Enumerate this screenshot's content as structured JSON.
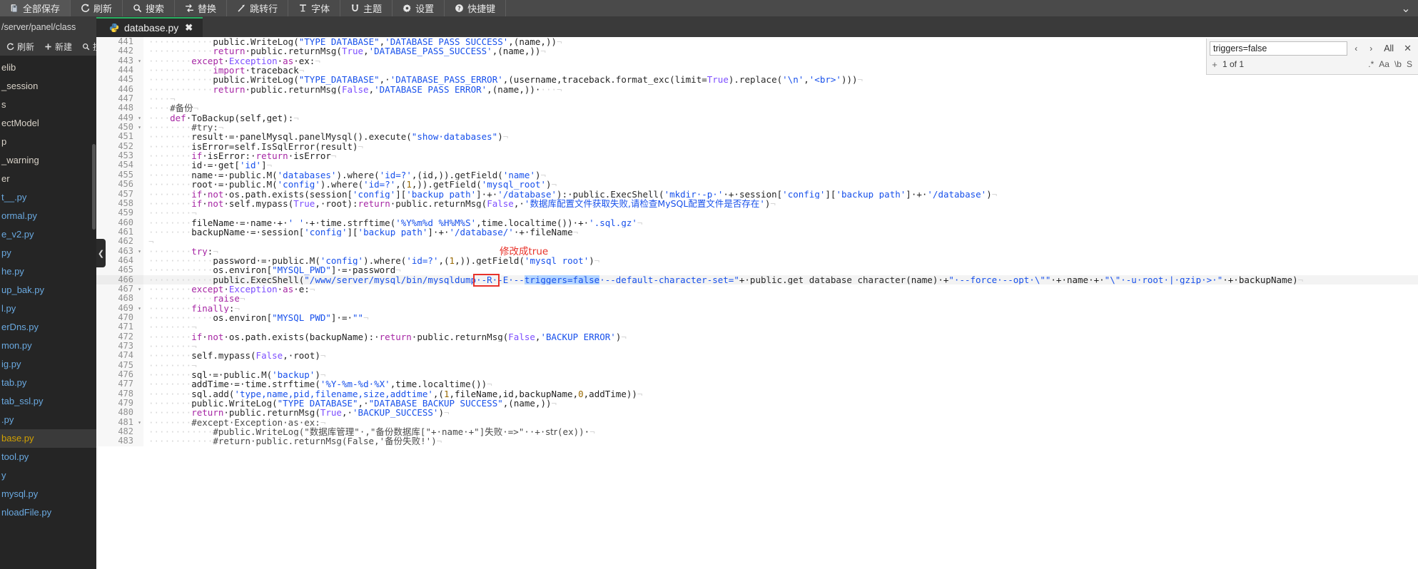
{
  "toolbar": {
    "items": [
      {
        "label": "全部保存",
        "icon": "save-all-icon"
      },
      {
        "label": "刷新",
        "icon": "refresh-icon"
      },
      {
        "label": "搜索",
        "icon": "search-icon"
      },
      {
        "label": "替换",
        "icon": "replace-icon"
      },
      {
        "label": "跳转行",
        "icon": "goto-line-icon"
      },
      {
        "label": "字体",
        "icon": "font-icon"
      },
      {
        "label": "主题",
        "icon": "theme-icon"
      },
      {
        "label": "设置",
        "icon": "gear-icon"
      },
      {
        "label": "快捷键",
        "icon": "help-icon"
      }
    ],
    "collapse_glyph": "⌄"
  },
  "path_bar": {
    "path": "/server/panel/class"
  },
  "tabs": [
    {
      "label": "database.py",
      "icon": "python-file-icon",
      "close_glyph": "✖",
      "active": true
    }
  ],
  "sidebar": {
    "toolbar": [
      {
        "label": "刷新",
        "icon": "refresh-icon"
      },
      {
        "label": "新建",
        "icon": "plus-icon"
      },
      {
        "label": "搜索",
        "icon": "search-icon"
      }
    ],
    "files": [
      {
        "name": "elib",
        "type": "dir"
      },
      {
        "name": "_session",
        "type": "dir"
      },
      {
        "name": "s",
        "type": "dir"
      },
      {
        "name": "ectModel",
        "type": "dir"
      },
      {
        "name": "p",
        "type": "dir"
      },
      {
        "name": "_warning",
        "type": "dir"
      },
      {
        "name": "er",
        "type": "dir"
      },
      {
        "name": "t__.py",
        "type": "file"
      },
      {
        "name": "ormal.py",
        "type": "file"
      },
      {
        "name": "e_v2.py",
        "type": "file"
      },
      {
        "name": "py",
        "type": "file"
      },
      {
        "name": "he.py",
        "type": "file"
      },
      {
        "name": "up_bak.py",
        "type": "file"
      },
      {
        "name": "l.py",
        "type": "file"
      },
      {
        "name": "erDns.py",
        "type": "file"
      },
      {
        "name": "mon.py",
        "type": "file"
      },
      {
        "name": "ig.py",
        "type": "file"
      },
      {
        "name": "tab.py",
        "type": "file"
      },
      {
        "name": "tab_ssl.py",
        "type": "file"
      },
      {
        "name": ".py",
        "type": "file"
      },
      {
        "name": "base.py",
        "type": "file",
        "active": true
      },
      {
        "name": "tool.py",
        "type": "file"
      },
      {
        "name": "y",
        "type": "file"
      },
      {
        "name": "mysql.py",
        "type": "file"
      },
      {
        "name": "nloadFile.py",
        "type": "file"
      }
    ]
  },
  "search_panel": {
    "query": "triggers=false",
    "placeholder": "",
    "prev_glyph": "‹",
    "next_glyph": "›",
    "all_label": "All",
    "close_glyph": "✕",
    "expand_glyph": "+",
    "result_count": "1 of 1",
    "flags": [
      {
        "label": ".*",
        "name": "regex-flag"
      },
      {
        "label": "Aa",
        "name": "match-case-flag"
      },
      {
        "label": "\\b",
        "name": "whole-word-flag"
      },
      {
        "label": "S",
        "name": "search-scope-flag"
      }
    ]
  },
  "annotation": {
    "note": "修改成true",
    "note_color": "#e8322a",
    "box_color": "#e8322a",
    "boxed_token": "false"
  },
  "editor": {
    "first_line": 441,
    "highlighted_line": 466,
    "selection": "triggers=false",
    "lines": [
      {
        "n": 441,
        "fold": "",
        "indent": 12,
        "html": "<span class=\"fn\">public</span>.<span class=\"fn\">WriteLog</span>(<span class=\"str\">\"TYPE_DATABASE\"</span>,<span class=\"str\">'DATABASE_PASS_SUCCESS'</span>,(name,))<span class=\"ws\">¬</span>"
      },
      {
        "n": 442,
        "fold": "",
        "indent": 12,
        "html": "<span class=\"kw\">return</span>·<span class=\"fn\">public</span>.<span class=\"fn\">returnMsg</span>(<span class=\"kw2\">True</span>,<span class=\"str\">'DATABASE_PASS_SUCCESS'</span>,(name,))<span class=\"ws\">¬</span>"
      },
      {
        "n": 443,
        "fold": "▾",
        "indent": 8,
        "html": "<span class=\"kw\">except</span>·<span class=\"kw2\">Exception</span>·<span class=\"kw\">as</span>·ex:<span class=\"ws\">¬</span>"
      },
      {
        "n": 444,
        "fold": "",
        "indent": 12,
        "html": "<span class=\"kw\">import</span>·traceback<span class=\"ws\">¬</span>"
      },
      {
        "n": 445,
        "fold": "",
        "indent": 12,
        "html": "<span class=\"fn\">public</span>.<span class=\"fn\">WriteLog</span>(<span class=\"str\">\"TYPE_DATABASE\"</span>,·<span class=\"str\">'DATABASE_PASS_ERROR'</span>,(username,traceback.<span class=\"fn\">format_exc</span>(limit=<span class=\"kw2\">True</span>).<span class=\"fn\">replace</span>(<span class=\"str\">'\\n'</span>,<span class=\"str\">'&lt;br&gt;'</span>)))<span class=\"ws\">¬</span>"
      },
      {
        "n": 446,
        "fold": "",
        "indent": 12,
        "html": "<span class=\"kw\">return</span>·<span class=\"fn\">public</span>.<span class=\"fn\">returnMsg</span>(<span class=\"kw2\">False</span>,<span class=\"str\">'DATABASE_PASS_ERROR'</span>,(name,))·<span class=\"ws\">···¬</span>"
      },
      {
        "n": 447,
        "fold": "",
        "indent": 4,
        "html": "<span class=\"ws\">¬</span>"
      },
      {
        "n": 448,
        "fold": "",
        "indent": 4,
        "html": "<span class=\"cmt\">#<span class=\"cn\">备份</span></span><span class=\"ws\">¬</span>"
      },
      {
        "n": 449,
        "fold": "▾",
        "indent": 4,
        "html": "<span class=\"kw\">def</span>·<span class=\"fn\">ToBackup</span>(self,get):<span class=\"ws\">¬</span>"
      },
      {
        "n": 450,
        "fold": "▾",
        "indent": 8,
        "html": "<span class=\"cmt\">#try:</span><span class=\"ws\">¬</span>"
      },
      {
        "n": 451,
        "fold": "",
        "indent": 8,
        "html": "result·=·panelMysql.<span class=\"fn\">panelMysql</span>().<span class=\"fn\">execute</span>(<span class=\"str\">\"show·databases\"</span>)<span class=\"ws\">¬</span>"
      },
      {
        "n": 452,
        "fold": "",
        "indent": 8,
        "html": "isError=self.<span class=\"fn\">IsSqlError</span>(result)<span class=\"ws\">¬</span>"
      },
      {
        "n": 453,
        "fold": "",
        "indent": 8,
        "html": "<span class=\"kw\">if</span>·isError:·<span class=\"kw\">return</span>·isError<span class=\"ws\">¬</span>"
      },
      {
        "n": 454,
        "fold": "",
        "indent": 8,
        "html": "id·=·get[<span class=\"str\">'id'</span>]<span class=\"ws\">¬</span>"
      },
      {
        "n": 455,
        "fold": "",
        "indent": 8,
        "html": "name·=·<span class=\"fn\">public</span>.<span class=\"fn\">M</span>(<span class=\"str\">'databases'</span>).<span class=\"fn\">where</span>(<span class=\"str\">'id=?'</span>,(id,)).<span class=\"fn\">getField</span>(<span class=\"str\">'name'</span>)<span class=\"ws\">¬</span>"
      },
      {
        "n": 456,
        "fold": "",
        "indent": 8,
        "html": "root·=·<span class=\"fn\">public</span>.<span class=\"fn\">M</span>(<span class=\"str\">'config'</span>).<span class=\"fn\">where</span>(<span class=\"str\">'id=?'</span>,(<span class=\"num\">1</span>,)).<span class=\"fn\">getField</span>(<span class=\"str\">'mysql_root'</span>)<span class=\"ws\">¬</span>"
      },
      {
        "n": 457,
        "fold": "",
        "indent": 8,
        "html": "<span class=\"kw\">if</span>·<span class=\"kw\">not</span>·os.path.<span class=\"fn\">exists</span>(session[<span class=\"str\">'config'</span>][<span class=\"str\">'backup_path'</span>]·+·<span class=\"str\">'/database'</span>):·<span class=\"fn\">public</span>.<span class=\"fn\">ExecShell</span>(<span class=\"str\">'mkdir·-p·'</span>·+·session[<span class=\"str\">'config'</span>][<span class=\"str\">'backup_path'</span>]·+·<span class=\"str\">'/database'</span>)<span class=\"ws\">¬</span>"
      },
      {
        "n": 458,
        "fold": "",
        "indent": 8,
        "html": "<span class=\"kw\">if</span>·<span class=\"kw\">not</span>·self.<span class=\"fn\">mypass</span>(<span class=\"kw2\">True</span>,·root):<span class=\"kw\">return</span>·<span class=\"fn\">public</span>.<span class=\"fn\">returnMsg</span>(<span class=\"kw2\">False</span>,·<span class=\"str\">'<span class=\"cn\">数据库配置文件获取失败,请检查MySQL配置文件是否存在</span>'</span>)<span class=\"ws\">¬</span>"
      },
      {
        "n": 459,
        "fold": "",
        "indent": 8,
        "html": "<span class=\"ws\">¬</span>"
      },
      {
        "n": 460,
        "fold": "",
        "indent": 8,
        "html": "fileName·=·name·+·<span class=\"str\">'_'</span>·+·time.<span class=\"fn\">strftime</span>(<span class=\"str\">'%Y%m%d_%H%M%S'</span>,time.<span class=\"fn\">localtime</span>())·+·<span class=\"str\">'.sql.gz'</span><span class=\"ws\">¬</span>"
      },
      {
        "n": 461,
        "fold": "",
        "indent": 8,
        "html": "backupName·=·session[<span class=\"str\">'config'</span>][<span class=\"str\">'backup_path'</span>]·+·<span class=\"str\">'/database/'</span>·+·fileName<span class=\"ws\">¬</span>"
      },
      {
        "n": 462,
        "fold": "",
        "indent": 0,
        "html": "<span class=\"ws\">¬</span>"
      },
      {
        "n": 463,
        "fold": "▾",
        "indent": 8,
        "html": "<span class=\"kw\">try</span>:<span class=\"ws\">¬</span>"
      },
      {
        "n": 464,
        "fold": "",
        "indent": 12,
        "html": "password·=·<span class=\"fn\">public</span>.<span class=\"fn\">M</span>(<span class=\"str\">'config'</span>).<span class=\"fn\">where</span>(<span class=\"str\">'id=?'</span>,(<span class=\"num\">1</span>,)).<span class=\"fn\">getField</span>(<span class=\"str\">'mysql_root'</span>)<span class=\"ws\">¬</span>"
      },
      {
        "n": 465,
        "fold": "",
        "indent": 12,
        "html": "os.environ[<span class=\"str\">\"MYSQL_PWD\"</span>]·=·password<span class=\"ws\">¬</span>"
      },
      {
        "n": 466,
        "fold": "",
        "indent": 12,
        "hl": true,
        "html": "<span class=\"fn\">public</span>.<span class=\"fn\">ExecShell</span>(<span class=\"str\">\"/www/server/mysql/bin/mysqldump·-R·-E·--<span class=\"sel\">triggers=false</span>·--default-character-set=\"</span>+·<span class=\"fn\">public</span>.<span class=\"fn\">get_database_character</span>(name)·+<span class=\"str\">\"·--force·--opt·\\\"\"</span>·+·name·+·<span class=\"str\">\"\\\"·-u·root·|·gzip·&gt;·\"</span>·+·backupName)<span class=\"ws\">¬</span>"
      },
      {
        "n": 467,
        "fold": "▾",
        "indent": 8,
        "html": "<span class=\"kw\">except</span>·<span class=\"kw2\">Exception</span>·<span class=\"kw\">as</span>·e:<span class=\"ws\">¬</span>"
      },
      {
        "n": 468,
        "fold": "",
        "indent": 12,
        "html": "<span class=\"kw\">raise</span><span class=\"ws\">¬</span>"
      },
      {
        "n": 469,
        "fold": "▾",
        "indent": 8,
        "html": "<span class=\"kw\">finally</span>:<span class=\"ws\">¬</span>"
      },
      {
        "n": 470,
        "fold": "",
        "indent": 12,
        "html": "os.environ[<span class=\"str\">\"MYSQL_PWD\"</span>]·=·<span class=\"str\">\"\"</span><span class=\"ws\">¬</span>"
      },
      {
        "n": 471,
        "fold": "",
        "indent": 8,
        "html": "<span class=\"ws\">¬</span>"
      },
      {
        "n": 472,
        "fold": "",
        "indent": 8,
        "html": "<span class=\"kw\">if</span>·<span class=\"kw\">not</span>·os.path.<span class=\"fn\">exists</span>(backupName):·<span class=\"kw\">return</span>·<span class=\"fn\">public</span>.<span class=\"fn\">returnMsg</span>(<span class=\"kw2\">False</span>,<span class=\"str\">'BACKUP_ERROR'</span>)<span class=\"ws\">¬</span>"
      },
      {
        "n": 473,
        "fold": "",
        "indent": 8,
        "html": "<span class=\"ws\">¬</span>"
      },
      {
        "n": 474,
        "fold": "",
        "indent": 8,
        "html": "self.<span class=\"fn\">mypass</span>(<span class=\"kw2\">False</span>,·root)<span class=\"ws\">¬</span>"
      },
      {
        "n": 475,
        "fold": "",
        "indent": 8,
        "html": "<span class=\"ws\">¬</span>"
      },
      {
        "n": 476,
        "fold": "",
        "indent": 8,
        "html": "sql·=·<span class=\"fn\">public</span>.<span class=\"fn\">M</span>(<span class=\"str\">'backup'</span>)<span class=\"ws\">¬</span>"
      },
      {
        "n": 477,
        "fold": "",
        "indent": 8,
        "html": "addTime·=·time.<span class=\"fn\">strftime</span>(<span class=\"str\">'%Y-%m-%d·%X'</span>,time.<span class=\"fn\">localtime</span>())<span class=\"ws\">¬</span>"
      },
      {
        "n": 478,
        "fold": "",
        "indent": 8,
        "html": "sql.<span class=\"fn\">add</span>(<span class=\"str\">'type,name,pid,filename,size,addtime'</span>,(<span class=\"num\">1</span>,fileName,id,backupName,<span class=\"num\">0</span>,addTime))<span class=\"ws\">¬</span>"
      },
      {
        "n": 479,
        "fold": "",
        "indent": 8,
        "html": "<span class=\"fn\">public</span>.<span class=\"fn\">WriteLog</span>(<span class=\"str\">\"TYPE_DATABASE\"</span>,·<span class=\"str\">\"DATABASE_BACKUP_SUCCESS\"</span>,(name,))<span class=\"ws\">¬</span>"
      },
      {
        "n": 480,
        "fold": "",
        "indent": 8,
        "html": "<span class=\"kw\">return</span>·<span class=\"fn\">public</span>.<span class=\"fn\">returnMsg</span>(<span class=\"kw2\">True</span>,·<span class=\"str\">'BACKUP_SUCCESS'</span>)<span class=\"ws\">¬</span>"
      },
      {
        "n": 481,
        "fold": "▾",
        "indent": 8,
        "html": "<span class=\"cmt\">#except·Exception·as·ex:</span><span class=\"ws\">¬</span>"
      },
      {
        "n": 482,
        "fold": "",
        "indent": 12,
        "html": "<span class=\"cmt\">#public.WriteLog(\"<span class=\"cn\">数据库管理</span>\"·,\"<span class=\"cn\">备份数据库</span>[\"+·name·+\"]<span class=\"cn\">失败</span>·=&gt;\"··+·<span class=\"cn\">str</span>(ex))</span>·<span class=\"ws\">¬</span>"
      },
      {
        "n": 483,
        "fold": "",
        "indent": 12,
        "html": "<span class=\"cmt\">#return·public.returnMsg(False,'<span class=\"cn\">备份失败</span>!')</span><span class=\"ws\">¬</span>"
      }
    ]
  }
}
